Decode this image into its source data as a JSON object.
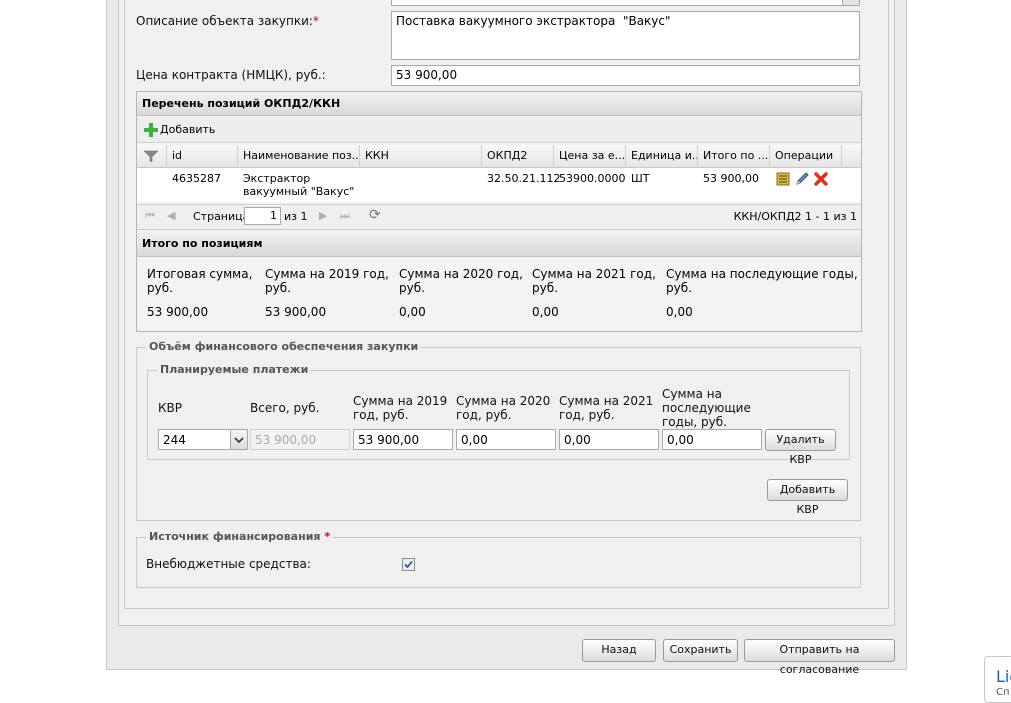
{
  "form": {
    "desc_label": "Описание объекта закупки:",
    "desc_required": "*",
    "desc_value": "Поставка вакуумного экстрактора  \"Вакус\"",
    "price_label": "Цена контракта (НМЦК), руб.:",
    "price_value": "53 900,00"
  },
  "positions": {
    "title": "Перечень позиций ОКПД2/ККН",
    "add_label": "Добавить",
    "columns": [
      "id",
      "Наименование поз...",
      "ККН",
      "ОКПД2",
      "Цена за е...",
      "Единица и...",
      "Итого по ...",
      "Операции"
    ],
    "rows": [
      {
        "id": "4635287",
        "name_line1": "Экстрактор",
        "name_line2": "вакуумный \"Вакус\"",
        "kkn": "",
        "okpd2": "32.50.21.112",
        "price": "53900.0000",
        "unit": "ШТ",
        "total": "53 900,00"
      }
    ],
    "pager": {
      "page_label": "Страница",
      "page_value": "1",
      "of_label": "из 1",
      "summary": "ККН/ОКПД2 1 - 1 из 1"
    }
  },
  "totals": {
    "title": "Итого по позициям",
    "items": [
      {
        "label1": "Итоговая сумма,",
        "label2": "руб.",
        "value": "53 900,00"
      },
      {
        "label1": "Сумма на 2019 год,",
        "label2": "руб.",
        "value": "53 900,00"
      },
      {
        "label1": "Сумма на 2020 год,",
        "label2": "руб.",
        "value": "0,00"
      },
      {
        "label1": "Сумма на 2021 год,",
        "label2": "руб.",
        "value": "0,00"
      },
      {
        "label1": "Сумма на последующие годы,",
        "label2": "руб.",
        "value": "0,00"
      }
    ]
  },
  "financing": {
    "legend": "Объём финансового обеспечения закупки",
    "payments_legend": "Планируемые платежи",
    "kvr_label": "КВР",
    "total_label": "Всего, руб.",
    "y2019_label1": "Сумма на 2019",
    "y2019_label2": "год, руб.",
    "y2020_label1": "Сумма на 2020",
    "y2020_label2": "год, руб.",
    "y2021_label1": "Сумма на 2021",
    "y2021_label2": "год, руб.",
    "later_label1": "Сумма на",
    "later_label2": "последующие",
    "later_label3": "годы, руб.",
    "kvr_value": "244",
    "total_value": "53 900,00",
    "y2019_value": "53 900,00",
    "y2020_value": "0,00",
    "y2021_value": "0,00",
    "later_value": "0,00",
    "delete_kvr": "Удалить КВР",
    "add_kvr": "Добавить КВР"
  },
  "source": {
    "legend": "Источник финансирования",
    "required": "*",
    "offbudget_label": "Внебюджетные средства:",
    "offbudget_checked": true
  },
  "footer": {
    "back": "Назад",
    "save": "Сохранить",
    "send": "Отправить на согласование"
  },
  "corner": {
    "text1": "Lig",
    "text2": "Сп"
  },
  "colors": {
    "required": "#dd0000",
    "add_icon": "#3cb043",
    "delete_icon": "#e03020"
  }
}
